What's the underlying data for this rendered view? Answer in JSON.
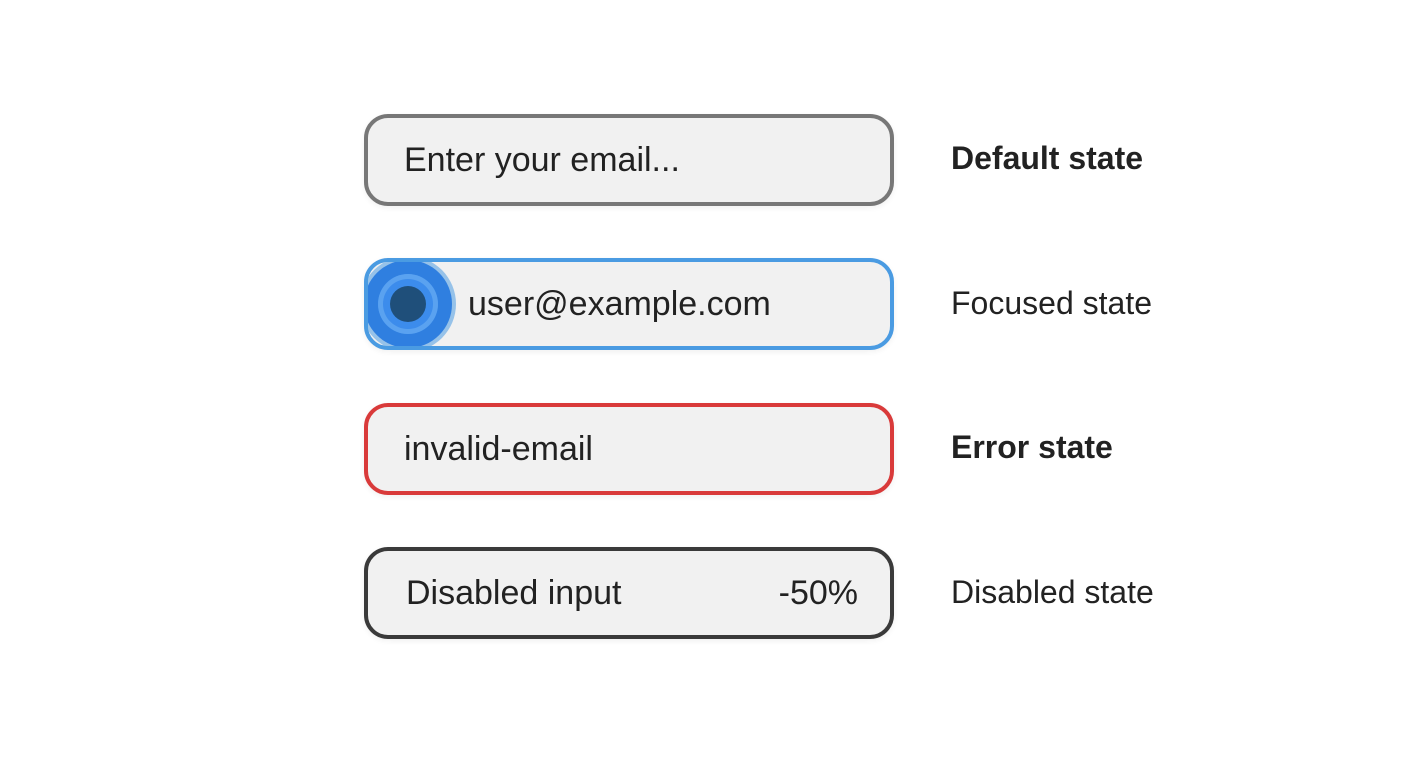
{
  "colors": {
    "default_border": "#777777",
    "focus_border": "#4a9be2",
    "error_border": "#d93a3a",
    "disabled_border": "#3a3a3a",
    "field_background": "#f1f1f1",
    "text": "#222222"
  },
  "fields": {
    "default": {
      "placeholder": "Enter your email...",
      "state_label": "Default state"
    },
    "focused": {
      "value": "user@example.com",
      "indicator_icon": "focus-ring-icon",
      "state_label": "Focused state"
    },
    "error": {
      "value": "invalid-email",
      "state_label": "Error state"
    },
    "disabled": {
      "value": "Disabled input",
      "opacity_note": "-50%",
      "state_label": "Disabled state"
    }
  }
}
